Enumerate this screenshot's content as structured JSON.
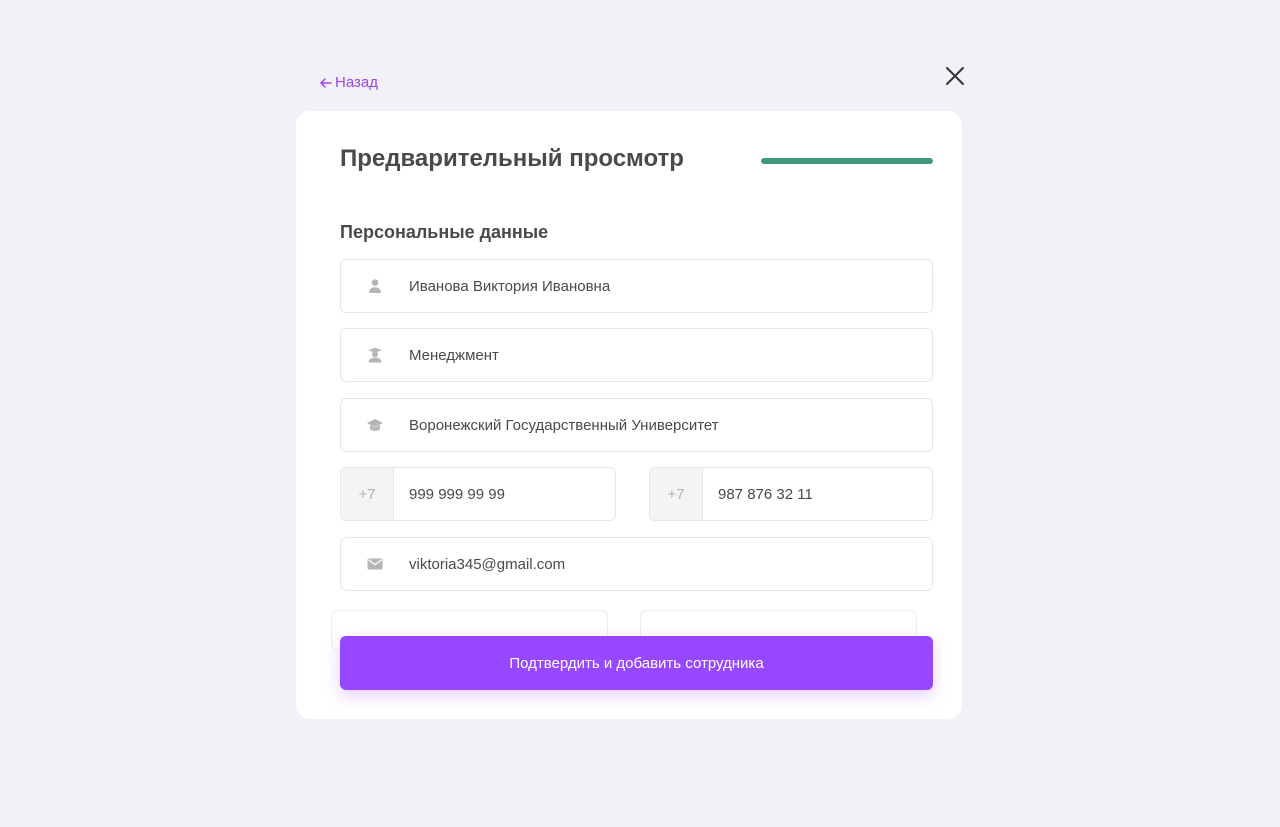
{
  "nav": {
    "back_label": "Назад"
  },
  "header": {
    "title": "Предварительный просмотр",
    "progress": 1.0
  },
  "section": {
    "title": "Персональные данные"
  },
  "fields": {
    "full_name": "Иванова Виктория Ивановна",
    "specialty": "Менеджмент",
    "university": "Воронежский Государственный Университет",
    "phone1": {
      "prefix": "+7",
      "number": "999 999 99 99"
    },
    "phone2": {
      "prefix": "+7",
      "number": "987 876 32 11"
    },
    "email": "viktoria345@gmail.com"
  },
  "actions": {
    "confirm_label": "Подтвердить и добавить сотрудника"
  },
  "icons": {
    "back": "arrow-left-icon",
    "close": "close-icon",
    "full_name": "person-icon",
    "specialty": "graduate-icon",
    "university": "graduation-cap-icon",
    "email": "mail-icon"
  },
  "colors": {
    "accent": "#9747ff",
    "link": "#9b45f0",
    "progress": "#3f9a7b",
    "background": "#f2f1f8"
  }
}
